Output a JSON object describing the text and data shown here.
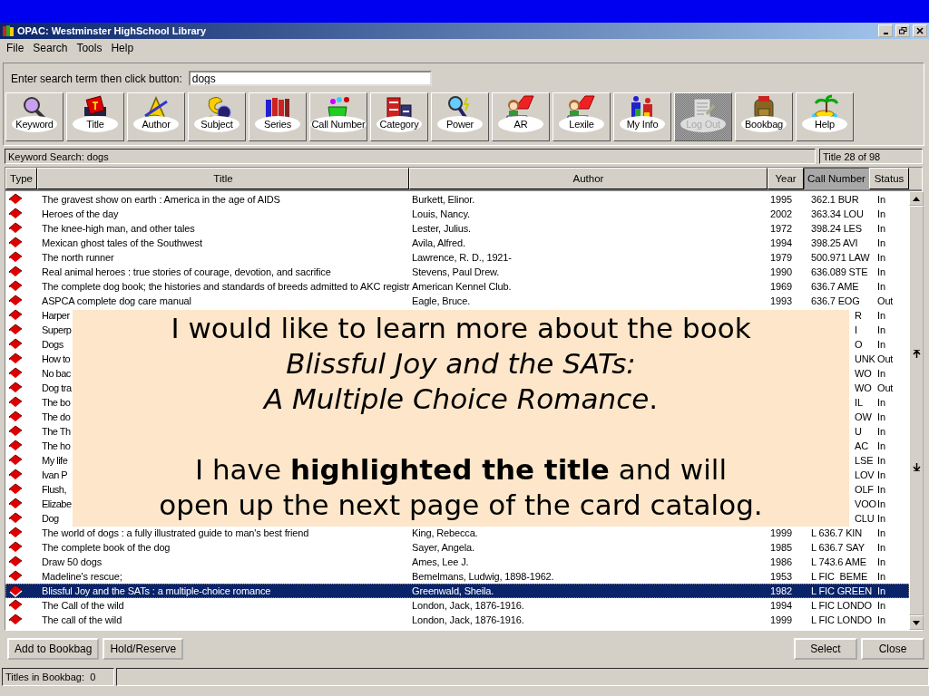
{
  "window": {
    "title": "OPAC: Westminster HighSchool Library"
  },
  "menu": [
    "File",
    "Search",
    "Tools",
    "Help"
  ],
  "search": {
    "label": "Enter search term then click button:",
    "value": "dogs"
  },
  "toolbar": [
    {
      "label": "Keyword",
      "disabled": false
    },
    {
      "label": "Title",
      "disabled": false
    },
    {
      "label": "Author",
      "disabled": false
    },
    {
      "label": "Subject",
      "disabled": false
    },
    {
      "label": "Series",
      "disabled": false
    },
    {
      "label": "Call Number",
      "disabled": false
    },
    {
      "label": "Category",
      "disabled": false
    },
    {
      "label": "Power",
      "disabled": false
    },
    {
      "label": "AR",
      "disabled": false
    },
    {
      "label": "Lexile",
      "disabled": false
    },
    {
      "label": "My Info",
      "disabled": false
    },
    {
      "label": "Log Out",
      "disabled": true
    },
    {
      "label": "Bookbag",
      "disabled": false
    },
    {
      "label": "Help",
      "disabled": false
    }
  ],
  "status_line": {
    "search": "Keyword Search: dogs",
    "position": "Title 28 of 98"
  },
  "table": {
    "columns": [
      {
        "label": "Type",
        "selected": false
      },
      {
        "label": "Title",
        "selected": false
      },
      {
        "label": "Author",
        "selected": false
      },
      {
        "label": "Year",
        "selected": false
      },
      {
        "label": "Call Number",
        "selected": true
      },
      {
        "label": "Status",
        "selected": false
      }
    ],
    "rows": [
      {
        "kind": "full",
        "title": "The gravest show on earth : America in the age of AIDS",
        "author": "Burkett, Elinor.",
        "year": "1995",
        "call_number": "362.1 BUR",
        "status": "In",
        "selected": false
      },
      {
        "kind": "full",
        "title": "Heroes of the day",
        "author": "Louis, Nancy.",
        "year": "2002",
        "call_number": "363.34 LOU",
        "status": "In",
        "selected": false
      },
      {
        "kind": "full",
        "title": "The knee-high man, and other tales",
        "author": "Lester, Julius.",
        "year": "1972",
        "call_number": "398.24 LES",
        "status": "In",
        "selected": false
      },
      {
        "kind": "full",
        "title": "Mexican ghost tales of the Southwest",
        "author": "Avila, Alfred.",
        "year": "1994",
        "call_number": "398.25 AVI",
        "status": "In",
        "selected": false
      },
      {
        "kind": "full",
        "title": "The north runner",
        "author": "Lawrence, R. D., 1921-",
        "year": "1979",
        "call_number": "500.971 LAW",
        "status": "In",
        "selected": false
      },
      {
        "kind": "full",
        "title": "Real animal heroes : true stories of courage, devotion, and sacrifice",
        "author": "Stevens, Paul Drew.",
        "year": "1990",
        "call_number": "636.089 STE",
        "status": "In",
        "selected": false
      },
      {
        "kind": "full",
        "title": "The complete dog book; the histories and standards of breeds admitted to AKC registr",
        "author": "American Kennel Club.",
        "year": "1969",
        "call_number": "636.7 AME",
        "status": "In",
        "selected": false
      },
      {
        "kind": "full",
        "title": "ASPCA complete dog care manual",
        "author": "Eagle, Bruce.",
        "year": "1993",
        "call_number": "636.7 EOG",
        "status": "Out",
        "selected": false
      },
      {
        "kind": "covered",
        "title": "Harper",
        "call_number": "R",
        "status": "In",
        "selected": false
      },
      {
        "kind": "covered",
        "title": "Superp",
        "call_number": "I",
        "status": "In",
        "selected": false
      },
      {
        "kind": "covered",
        "title": "Dogs",
        "call_number": "O",
        "status": "In",
        "selected": false
      },
      {
        "kind": "covered",
        "title": "How to",
        "call_number": "UNK",
        "status": "Out",
        "selected": false
      },
      {
        "kind": "covered",
        "title": "No bac",
        "call_number": "WO",
        "status": "In",
        "selected": false
      },
      {
        "kind": "covered",
        "title": "Dog tra",
        "call_number": "WO",
        "status": "Out",
        "selected": false
      },
      {
        "kind": "covered",
        "title": "The bo",
        "call_number": "IL",
        "status": "In",
        "selected": false
      },
      {
        "kind": "covered",
        "title": "The do",
        "call_number": "OW",
        "status": "In",
        "selected": false
      },
      {
        "kind": "covered",
        "title": "The Th",
        "call_number": "U",
        "status": "In",
        "selected": false
      },
      {
        "kind": "covered",
        "title": "The ho",
        "call_number": "AC",
        "status": "In",
        "selected": false
      },
      {
        "kind": "covered",
        "title": "My life",
        "call_number": "LSE",
        "status": "In",
        "selected": false
      },
      {
        "kind": "covered",
        "title": "Ivan P",
        "call_number": "LOV",
        "status": "In",
        "selected": false
      },
      {
        "kind": "covered",
        "title": "Flush,",
        "call_number": "OLF",
        "status": "In",
        "selected": false
      },
      {
        "kind": "covered",
        "title": "Elizabe",
        "call_number": "VOO",
        "status": "In",
        "selected": false
      },
      {
        "kind": "covered",
        "title": "Dog",
        "call_number": "CLU",
        "status": "In",
        "selected": false
      },
      {
        "kind": "full",
        "title": "The world of dogs : a fully illustrated guide to man's best friend",
        "author": "King, Rebecca.",
        "year": "1999",
        "call_number": "L 636.7 KIN",
        "status": "In",
        "selected": false
      },
      {
        "kind": "full",
        "title": "The complete book of the dog",
        "author": "Sayer, Angela.",
        "year": "1985",
        "call_number": "L 636.7 SAY",
        "status": "In",
        "selected": false
      },
      {
        "kind": "full",
        "title": "Draw 50 dogs",
        "author": "Ames, Lee J.",
        "year": "1986",
        "call_number": "L 743.6 AME",
        "status": "In",
        "selected": false
      },
      {
        "kind": "full",
        "title": "Madeline's rescue;",
        "author": "Bemelmans, Ludwig, 1898-1962.",
        "year": "1953",
        "call_number": "L FIC  BEME",
        "status": "In",
        "selected": false
      },
      {
        "kind": "full",
        "title": "Blissful Joy and the SATs : a multiple-choice romance",
        "author": "Greenwald, Sheila.",
        "year": "1982",
        "call_number": "L FIC GREEN",
        "status": "In",
        "selected": true
      },
      {
        "kind": "full",
        "title": "The Call of the wild",
        "author": "London, Jack, 1876-1916.",
        "year": "1994",
        "call_number": "L FIC LONDO",
        "status": "In",
        "selected": false
      },
      {
        "kind": "full",
        "title": "The call of the wild",
        "author": "London, Jack, 1876-1916.",
        "year": "1999",
        "call_number": "L FIC LONDO",
        "status": "In",
        "selected": false
      }
    ]
  },
  "buttons_left": [
    "Add to Bookbag",
    "Hold/Reserve"
  ],
  "buttons_right": [
    "Select",
    "Close"
  ],
  "status_bar": {
    "bookbag": "Titles in Bookbag:  0"
  },
  "callout": {
    "paragraphs": [
      [
        "I would like to learn more about the book",
        "*Blissful Joy and the SATs:*",
        "*A Multiple Choice Romance*."
      ],
      [
        "I have **highlighted the title** and will",
        "open up the next page of the card catalog."
      ]
    ]
  }
}
